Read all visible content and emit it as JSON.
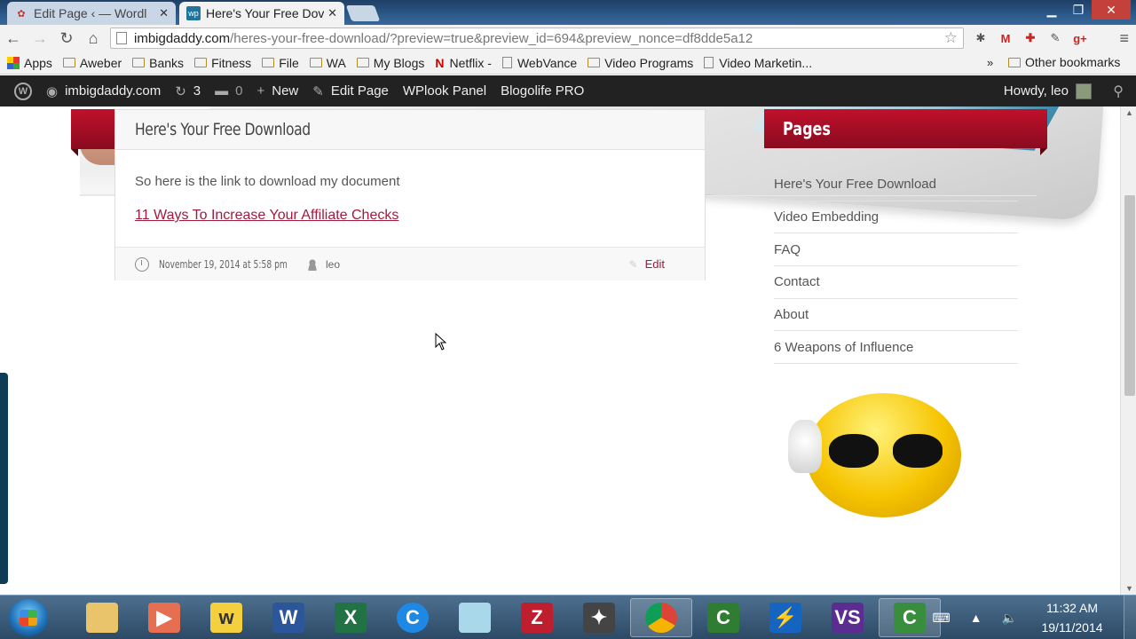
{
  "browser": {
    "tabs": [
      {
        "title": "Edit Page ‹ — Wordl",
        "active": false
      },
      {
        "title": "Here's Your Free Dov",
        "active": true
      }
    ],
    "url_host": "imbigdaddy.com",
    "url_path": "/heres-your-free-download/?preview=true&preview_id=694&preview_nonce=df8dde5a12",
    "bookmarks": [
      "Apps",
      "Aweber",
      "Banks",
      "Fitness",
      "File",
      "WA",
      "My Blogs",
      "Netflix -",
      "WebVance",
      "Video Programs",
      "Video Marketin..."
    ],
    "bookmarks_more": "»",
    "other_bookmarks": "Other bookmarks"
  },
  "adminbar": {
    "site": "imbigdaddy.com",
    "updates": "3",
    "comments": "0",
    "new": "New",
    "edit_page": "Edit Page",
    "wplook": "WPlook Panel",
    "blogolife": "Blogolife PRO",
    "howdy": "Howdy, leo"
  },
  "post": {
    "title": "Here's Your Free Download",
    "body": "So here is the link to download my document",
    "link": "11 Ways To Increase Your Affiliate Checks",
    "date": "November 19, 2014 at 5:58 pm",
    "author": "leo",
    "edit": "Edit"
  },
  "sidebar": {
    "title": "Pages",
    "pages": [
      "Here's Your Free Download",
      "Video Embedding",
      "FAQ",
      "Contact",
      "About",
      "6 Weapons of Influence"
    ]
  },
  "taskbar": {
    "time": "11:32 AM",
    "date": "19/11/2014"
  },
  "colors": {
    "accent": "#a01c3c",
    "ribbon": "#b0102a",
    "adminbar": "#222222"
  }
}
